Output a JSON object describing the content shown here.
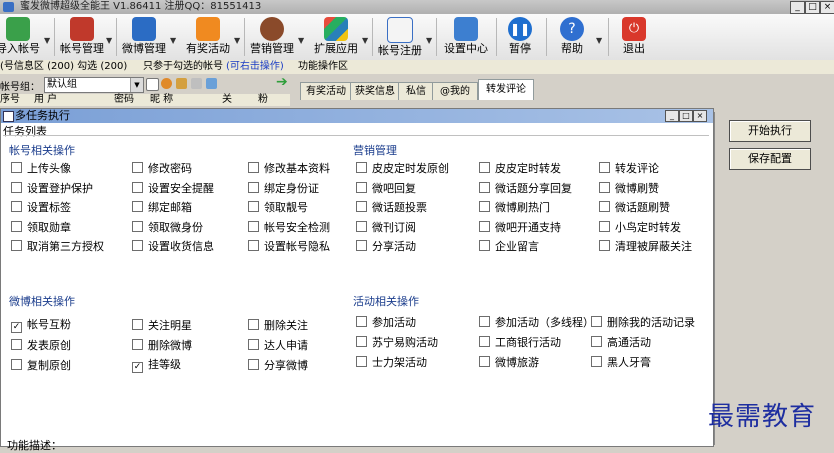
{
  "window": {
    "title": "蜜发微博超级全能王  V1.86411  注册QQ：81551413"
  },
  "toolbar": {
    "buttons": [
      {
        "label": "导入帐号",
        "icon": "import-account-icon"
      },
      {
        "label": "帐号管理",
        "icon": "account-manage-icon"
      },
      {
        "label": "微博管理",
        "icon": "weibo-manage-icon"
      },
      {
        "label": "有奖活动",
        "icon": "prize-activity-icon"
      },
      {
        "label": "营销管理",
        "icon": "marketing-icon"
      },
      {
        "label": "扩展应用",
        "icon": "extension-app-icon"
      },
      {
        "label": "帐号注册",
        "icon": "account-register-icon"
      },
      {
        "label": "设置中心",
        "icon": "settings-icon"
      },
      {
        "label": "暂停",
        "icon": "pause-icon"
      },
      {
        "label": "帮助",
        "icon": "help-icon"
      },
      {
        "label": "退出",
        "icon": "exit-icon"
      }
    ]
  },
  "infobar": {
    "left": "(号信息区 (200)  勾选 (200)",
    "middle": "只参于勾选的帐号",
    "link": "(可右击操作)",
    "right": "功能操作区"
  },
  "accountpanel": {
    "group_label": "帐号组：",
    "group_value": "默认组",
    "columns": [
      "序号",
      "用 户",
      "密码",
      "昵 称",
      "关",
      "粉"
    ]
  },
  "tabs": [
    "有奖活动",
    "获奖信息",
    "私信",
    "@我的",
    "转发评论"
  ],
  "active_tab": "转发评论",
  "dialog": {
    "title": "多任务执行",
    "subtitle": "任务列表",
    "sections": {
      "account": {
        "title": "帐号相关操作",
        "items": [
          {
            "label": "上传头像",
            "checked": false
          },
          {
            "label": "修改密码",
            "checked": false
          },
          {
            "label": "修改基本资料",
            "checked": false
          },
          {
            "label": "设置登护保护",
            "checked": false
          },
          {
            "label": "设置安全提醒",
            "checked": false
          },
          {
            "label": "绑定身份证",
            "checked": false
          },
          {
            "label": "设置标签",
            "checked": false
          },
          {
            "label": "绑定邮箱",
            "checked": false
          },
          {
            "label": "领取靓号",
            "checked": false
          },
          {
            "label": "领取勋章",
            "checked": false
          },
          {
            "label": "领取微身份",
            "checked": false
          },
          {
            "label": "帐号安全检测",
            "checked": false
          },
          {
            "label": "取消第三方授权",
            "checked": false
          },
          {
            "label": "设置收货信息",
            "checked": false
          },
          {
            "label": "设置帐号隐私",
            "checked": false
          }
        ]
      },
      "marketing": {
        "title": "营销管理",
        "items": [
          {
            "label": "皮皮定时发原创",
            "checked": false
          },
          {
            "label": "皮皮定时转发",
            "checked": false
          },
          {
            "label": "转发评论",
            "checked": false
          },
          {
            "label": "微吧回复",
            "checked": false
          },
          {
            "label": "微话题分享回复",
            "checked": false
          },
          {
            "label": "微博刷赞",
            "checked": false
          },
          {
            "label": "微话题投票",
            "checked": false
          },
          {
            "label": "微博刷热门",
            "checked": false
          },
          {
            "label": "微话题刷赞",
            "checked": false
          },
          {
            "label": "微刊订阅",
            "checked": false
          },
          {
            "label": "微吧开通支持",
            "checked": false
          },
          {
            "label": "小鸟定时转发",
            "checked": false
          },
          {
            "label": "分享活动",
            "checked": false
          },
          {
            "label": "企业留言",
            "checked": false
          },
          {
            "label": "清理被屏蔽关注",
            "checked": false
          }
        ]
      },
      "weibo": {
        "title": "微博相关操作",
        "items": [
          {
            "label": "帐号互粉",
            "checked": true
          },
          {
            "label": "关注明星",
            "checked": false
          },
          {
            "label": "删除关注",
            "checked": false
          },
          {
            "label": "发表原创",
            "checked": false
          },
          {
            "label": "删除微博",
            "checked": false
          },
          {
            "label": "达人申请",
            "checked": false
          },
          {
            "label": "复制原创",
            "checked": false
          },
          {
            "label": "挂等级",
            "checked": true
          },
          {
            "label": "分享微博",
            "checked": false
          }
        ]
      },
      "activity": {
        "title": "活动相关操作",
        "items": [
          {
            "label": "参加活动",
            "checked": false
          },
          {
            "label": "参加活动（多线程）",
            "checked": false
          },
          {
            "label": "删除我的活动记录",
            "checked": false
          },
          {
            "label": "苏宁易购活动",
            "checked": false
          },
          {
            "label": "工商银行活动",
            "checked": false
          },
          {
            "label": "高通活动",
            "checked": false
          },
          {
            "label": "士力架活动",
            "checked": false
          },
          {
            "label": "微博旅游",
            "checked": false
          },
          {
            "label": "黑人牙膏",
            "checked": false
          }
        ]
      }
    },
    "footer": "功能描述："
  },
  "side_buttons": {
    "start": "开始执行",
    "save": "保存配置"
  },
  "watermark": "最需教育"
}
